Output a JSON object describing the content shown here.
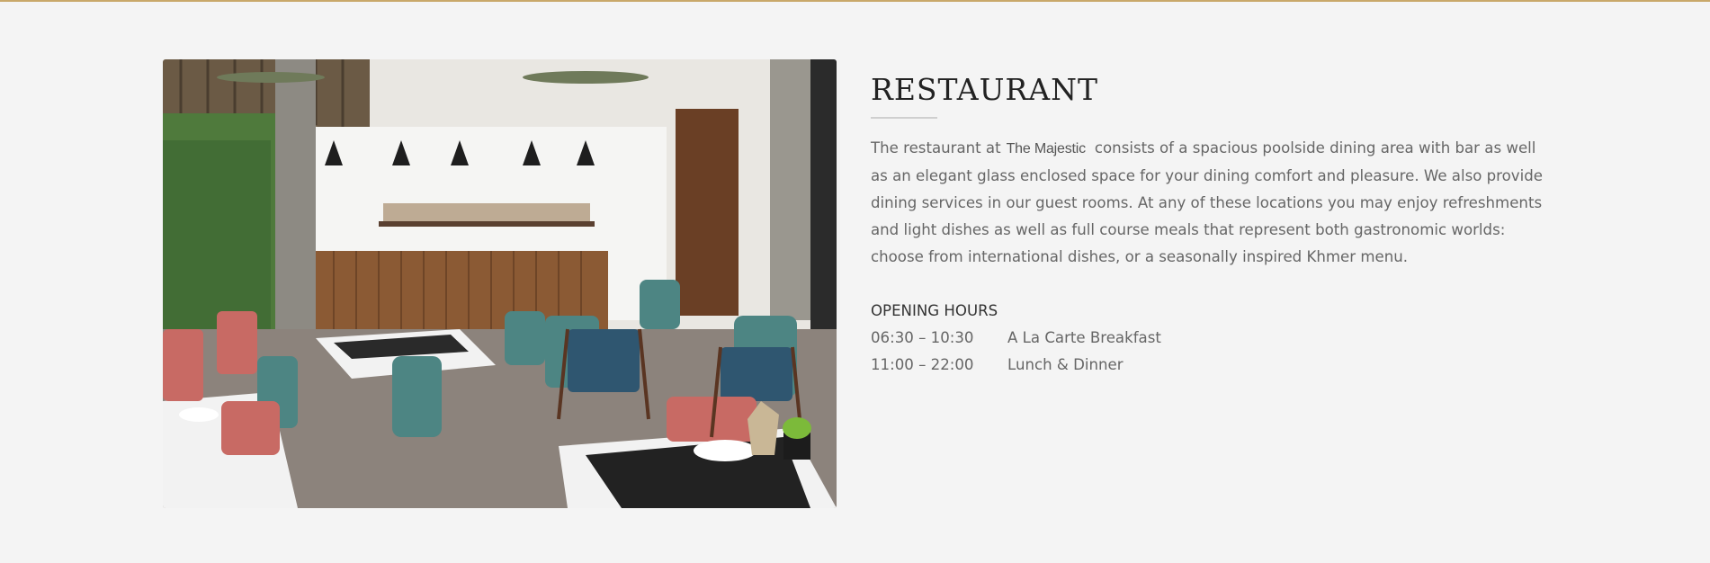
{
  "section": {
    "title": "RESTAURANT",
    "description_before": "The restaurant at",
    "brand": "The Majestic",
    "description_after": "consists of a spacious poolside dining area with bar as well as an elegant glass enclosed space for your dining comfort and pleasure. We also provide dining services in our guest rooms. At any of these locations you may enjoy refreshments and light dishes as well as full course meals that represent both gastronomic worlds: choose from international dishes, or a seasonally inspired Khmer menu."
  },
  "hours": {
    "title": "OPENING HOURS",
    "rows": [
      {
        "time": "06:30 – 10:30",
        "label": "A La Carte Breakfast"
      },
      {
        "time": "11:00 – 22:00",
        "label": "Lunch & Dinner"
      }
    ]
  },
  "colors": {
    "accent_rule": "#c9a86a",
    "background": "#f4f4f4"
  },
  "image": {
    "icon": "restaurant-photo"
  }
}
